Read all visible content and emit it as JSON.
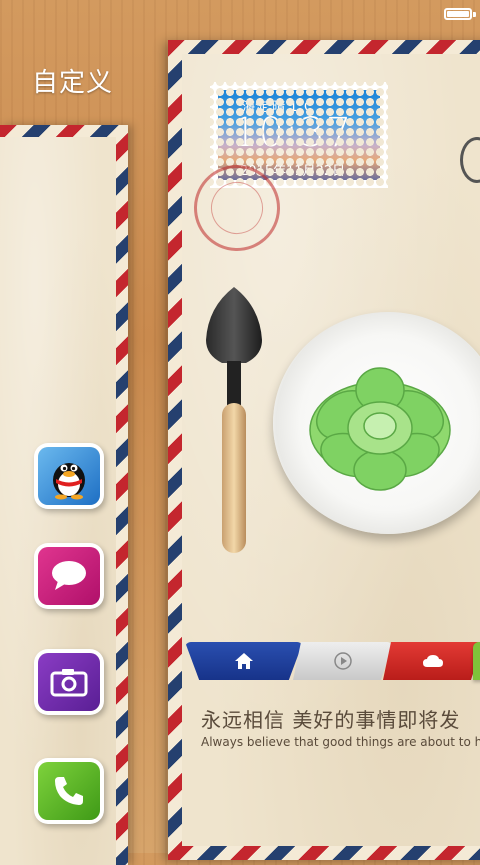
{
  "status_bar": {
    "battery_icon": "battery-full-icon"
  },
  "header": {
    "title": "自定义"
  },
  "left_dock": {
    "apps": [
      {
        "name": "QQ",
        "icon": "qq-penguin-icon"
      },
      {
        "name": "Messages",
        "icon": "message-bubble-icon"
      },
      {
        "name": "Camera",
        "icon": "camera-icon"
      },
      {
        "name": "Phone",
        "icon": "phone-icon"
      }
    ]
  },
  "weather_widget": {
    "location_weather": "海淀 晴 1°C",
    "time": "10:37",
    "date": "2015年11月22日"
  },
  "tabs": [
    {
      "icon": "home-icon",
      "color": "#1f44a0"
    },
    {
      "icon": "play-icon",
      "color": "#dddddd"
    },
    {
      "icon": "cloud-icon",
      "color": "#d02a26"
    },
    {
      "icon": "",
      "color": "#7fc33a"
    }
  ],
  "quote": {
    "chinese": "永远相信 美好的事情即将发",
    "english": "Always believe that good things are about to ha"
  },
  "colors": {
    "airmail_red": "#c4262e",
    "airmail_blue": "#25406f",
    "paper": "#efe4cd",
    "wood": "#cd9155"
  }
}
